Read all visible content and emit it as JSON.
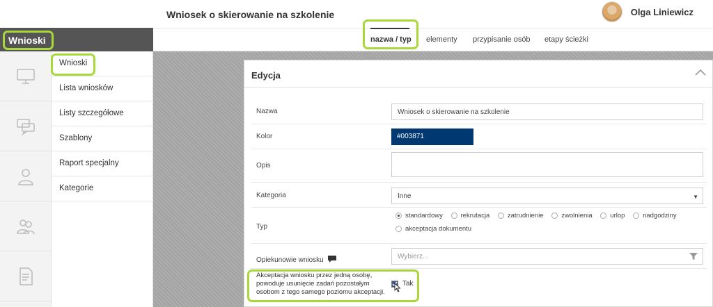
{
  "header": {
    "title": "Wniosek o skierowanie na szkolenie",
    "user_name": "Olga Liniewicz"
  },
  "sidebar": {
    "title": "Wnioski",
    "icons": [
      "monitor-icon",
      "chat-icon",
      "person-icon",
      "group-icon",
      "document-icon"
    ],
    "items": [
      {
        "label": "Wnioski"
      },
      {
        "label": "Lista wniosków"
      },
      {
        "label": "Listy szczegółowe"
      },
      {
        "label": "Szablony"
      },
      {
        "label": "Raport specjalny"
      },
      {
        "label": "Kategorie"
      }
    ]
  },
  "tabs": [
    {
      "label": "nazwa / typ",
      "active": true
    },
    {
      "label": "elementy"
    },
    {
      "label": "przypisanie osób"
    },
    {
      "label": "etapy ścieżki"
    }
  ],
  "panel": {
    "title": "Edycja",
    "fields": {
      "nazwa": {
        "label": "Nazwa",
        "value": "Wniosek o skierowanie na szkolenie"
      },
      "kolor": {
        "label": "Kolor",
        "value": "#003871"
      },
      "opis": {
        "label": "Opis",
        "value": ""
      },
      "kategoria": {
        "label": "Kategoria",
        "value": "Inne"
      },
      "typ": {
        "label": "Typ",
        "options": [
          "standardowy",
          "rekrutacja",
          "zatrudnienie",
          "zwolnienia",
          "urlop",
          "nadgodziny",
          "akceptacja dokumentu"
        ],
        "selected": "standardowy"
      },
      "opiekunowie": {
        "label": "Opiekunowie wniosku",
        "placeholder": "Wybierz..."
      },
      "akceptacja": {
        "label": "Akceptacja wniosku przez jedną osobę, powoduje usunięcie zadań pozostałym osobom z tego samego poziomu akceptacji.",
        "checkbox_label": "Tak",
        "checked": true
      }
    }
  },
  "colors": {
    "accent": "#a8d83a",
    "sidebar_header": "#555555",
    "color_swatch": "#003871"
  }
}
